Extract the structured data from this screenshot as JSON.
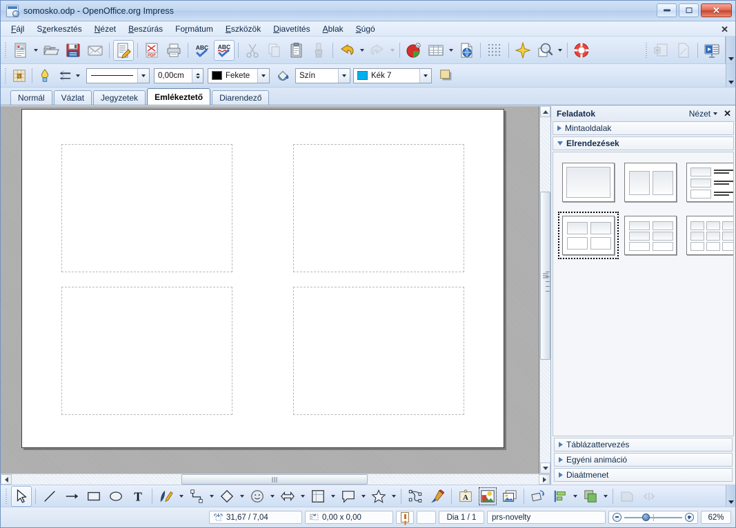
{
  "window": {
    "title": "somosko.odp - OpenOffice.org Impress",
    "app_icon": "impress-document-icon",
    "minimize_label": "Minimize",
    "maximize_label": "Maximize",
    "close_label": "✕"
  },
  "menubar": {
    "items": [
      {
        "label": "Fájl",
        "accel": "F"
      },
      {
        "label": "Szerkesztés",
        "accel": "z"
      },
      {
        "label": "Nézet",
        "accel": "N"
      },
      {
        "label": "Beszúrás",
        "accel": "B"
      },
      {
        "label": "Formátum",
        "accel": "r"
      },
      {
        "label": "Eszközök",
        "accel": "E"
      },
      {
        "label": "Diavetítés",
        "accel": "D"
      },
      {
        "label": "Ablak",
        "accel": "A"
      },
      {
        "label": "Súgó",
        "accel": "S"
      }
    ],
    "close_document_label": "✕"
  },
  "standard_toolbar": {
    "items": [
      {
        "name": "new-document-icon",
        "label": "Új",
        "state": "normal",
        "dropdown": true
      },
      {
        "name": "open-document-icon",
        "label": "Megnyitás",
        "state": "normal"
      },
      {
        "name": "save-document-icon",
        "label": "Mentés",
        "state": "normal"
      },
      {
        "name": "email-document-icon",
        "label": "Dokumentum küldése e-mailben",
        "state": "normal"
      },
      {
        "name": "edit-file-icon",
        "label": "Szerkesztés módban",
        "state": "active"
      },
      {
        "name": "export-pdf-icon",
        "label": "Exportálás PDF-be",
        "state": "normal"
      },
      {
        "name": "print-icon",
        "label": "Nyomtatás",
        "state": "normal"
      },
      {
        "name": "spellcheck-icon",
        "label": "Helyesírás-ellenőrzés",
        "state": "normal"
      },
      {
        "name": "autospellcheck-icon",
        "label": "Automatikus helyesírás-ellenőrzés",
        "state": "active"
      },
      {
        "name": "cut-icon",
        "label": "Kivágás",
        "state": "disabled"
      },
      {
        "name": "copy-icon",
        "label": "Másolás",
        "state": "disabled"
      },
      {
        "name": "paste-icon",
        "label": "Beillesztés",
        "state": "normal"
      },
      {
        "name": "clone-formatting-icon",
        "label": "Klónozott formázás",
        "state": "disabled"
      },
      {
        "name": "undo-icon",
        "label": "Visszavonás",
        "state": "normal",
        "dropdown": true
      },
      {
        "name": "redo-icon",
        "label": "Újra",
        "state": "disabled",
        "dropdown": true
      },
      {
        "name": "chart-icon",
        "label": "Diagram",
        "state": "normal"
      },
      {
        "name": "table-icon",
        "label": "Táblázat",
        "state": "normal",
        "dropdown": true
      },
      {
        "name": "hyperlink-icon",
        "label": "Hiperhivatkozás",
        "state": "normal"
      },
      {
        "name": "grid-icon",
        "label": "Rács megjelenítése",
        "state": "normal"
      },
      {
        "name": "effects-icon",
        "label": "Effektusok",
        "state": "normal"
      },
      {
        "name": "zoom-icon",
        "label": "Nagyítás",
        "state": "normal",
        "dropdown": true
      },
      {
        "name": "help-icon",
        "label": "OpenOffice.org Súgó",
        "state": "normal"
      }
    ],
    "secondary_items": [
      {
        "name": "new-slide-icon",
        "label": "Dia",
        "state": "disabled"
      },
      {
        "name": "slide-layout-icon",
        "label": "Elrendezés",
        "state": "disabled"
      },
      {
        "name": "start-slideshow-icon",
        "label": "Diavetítés",
        "state": "normal"
      }
    ],
    "overflow_label": "▼"
  },
  "line_fill_toolbar": {
    "edit_points_icon": "edit-points-icon",
    "glue_points_icon": "glue-points-icon",
    "arrow_style_icon": "arrow-style-icon",
    "line_style_value": "────────",
    "line_width_value": "0,00cm",
    "line_color_value": "Fekete",
    "line_color_hex": "#000000",
    "fill_bucket_icon": "fill-bucket-icon",
    "fill_type_value": "Szín",
    "fill_color_value": "Kék 7",
    "fill_color_hex": "#00b0f0",
    "shadow_icon": "shadow-icon",
    "overflow_label": "▼"
  },
  "view_tabs": {
    "tabs": [
      {
        "label": "Normál",
        "selected": false
      },
      {
        "label": "Vázlat",
        "selected": false
      },
      {
        "label": "Jegyzetek",
        "selected": false
      },
      {
        "label": "Emlékeztető",
        "selected": true
      },
      {
        "label": "Diarendező",
        "selected": false
      }
    ]
  },
  "canvas": {
    "slide_placeholders": [
      {
        "name": "handout-frame-1"
      },
      {
        "name": "handout-frame-2"
      },
      {
        "name": "handout-frame-3"
      },
      {
        "name": "handout-frame-4"
      }
    ]
  },
  "taskpane": {
    "title": "Feladatok",
    "view_label": "Nézet",
    "close_label": "✕",
    "sections": [
      {
        "label": "Mintaoldalak",
        "expanded": false
      },
      {
        "label": "Elrendezések",
        "expanded": true
      }
    ],
    "footer_sections": [
      {
        "label": "Táblázattervezés",
        "expanded": false
      },
      {
        "label": "Egyéni animáció",
        "expanded": false
      },
      {
        "label": "Diaátmenet",
        "expanded": false
      }
    ],
    "layouts": [
      {
        "name": "layout-blank-single",
        "type": "single",
        "selected": false
      },
      {
        "name": "layout-two-content",
        "type": "two",
        "selected": false
      },
      {
        "name": "layout-three-rows-text",
        "type": "rows-text",
        "selected": false
      },
      {
        "name": "layout-four-content",
        "type": "four",
        "selected": true
      },
      {
        "name": "layout-six-content",
        "type": "six",
        "selected": false
      },
      {
        "name": "layout-nine-content",
        "type": "nine",
        "selected": false
      }
    ]
  },
  "drawing_toolbar": {
    "items": [
      {
        "name": "select-icon",
        "label": "Kijelölés",
        "state": "active"
      },
      {
        "name": "line-icon",
        "label": "Vonal",
        "state": "normal"
      },
      {
        "name": "line-arrow-icon",
        "label": "Vonal nyíllal",
        "state": "normal"
      },
      {
        "name": "rectangle-icon",
        "label": "Téglalap",
        "state": "normal"
      },
      {
        "name": "ellipse-icon",
        "label": "Ellipszis",
        "state": "normal"
      },
      {
        "name": "text-icon",
        "label": "Szöveg",
        "state": "normal"
      },
      {
        "name": "curve-icon",
        "label": "Görbe",
        "state": "normal",
        "dropdown": true
      },
      {
        "name": "connector-icon",
        "label": "Összekötő",
        "state": "normal",
        "dropdown": true
      },
      {
        "name": "basic-shapes-icon",
        "label": "Alapformák",
        "state": "normal",
        "dropdown": true
      },
      {
        "name": "symbol-shapes-icon",
        "label": "Szimbólumok",
        "state": "normal",
        "dropdown": true
      },
      {
        "name": "block-arrows-icon",
        "label": "Tömbnyilak",
        "state": "normal",
        "dropdown": true
      },
      {
        "name": "flowchart-icon",
        "label": "Folyamatábra",
        "state": "normal",
        "dropdown": true
      },
      {
        "name": "callouts-icon",
        "label": "Ábrafeliratok",
        "state": "normal",
        "dropdown": true
      },
      {
        "name": "stars-icon",
        "label": "Csillagok",
        "state": "normal",
        "dropdown": true
      },
      {
        "name": "points-icon",
        "label": "Pontok",
        "state": "normal"
      },
      {
        "name": "glue-points-icon",
        "label": "Ragasztópontok",
        "state": "normal"
      },
      {
        "name": "fontwork-icon",
        "label": "Fontwork Gallery",
        "state": "normal"
      },
      {
        "name": "insert-image-icon",
        "label": "Kép beszúrása",
        "state": "active"
      },
      {
        "name": "gallery-icon",
        "label": "Gyűjtemény",
        "state": "normal"
      },
      {
        "name": "rotate-icon",
        "label": "Forgatás",
        "state": "normal"
      },
      {
        "name": "align-icon",
        "label": "Igazítás",
        "state": "normal",
        "dropdown": true
      },
      {
        "name": "arrange-icon",
        "label": "Elrendezés",
        "state": "normal",
        "dropdown": true
      },
      {
        "name": "shadow-3d-icon",
        "label": "Árnyék",
        "state": "disabled"
      },
      {
        "name": "interaction-icon",
        "label": "Kölcsönhatás",
        "state": "disabled"
      }
    ],
    "overflow_label": "▼"
  },
  "statusbar": {
    "cursor_position": "31,67 / 7,04",
    "object_size": "0,00 x 0,00",
    "position_icon": "cursor-position-icon",
    "size_icon": "object-size-icon",
    "modified_icon": "document-modified-icon",
    "signature_value": "",
    "slide_counter": "Dia 1 / 1",
    "master_name": "prs-novelty",
    "zoom_out_label": "−",
    "zoom_in_label": "+",
    "zoom_value": "62%",
    "zoom_percent": 62
  }
}
